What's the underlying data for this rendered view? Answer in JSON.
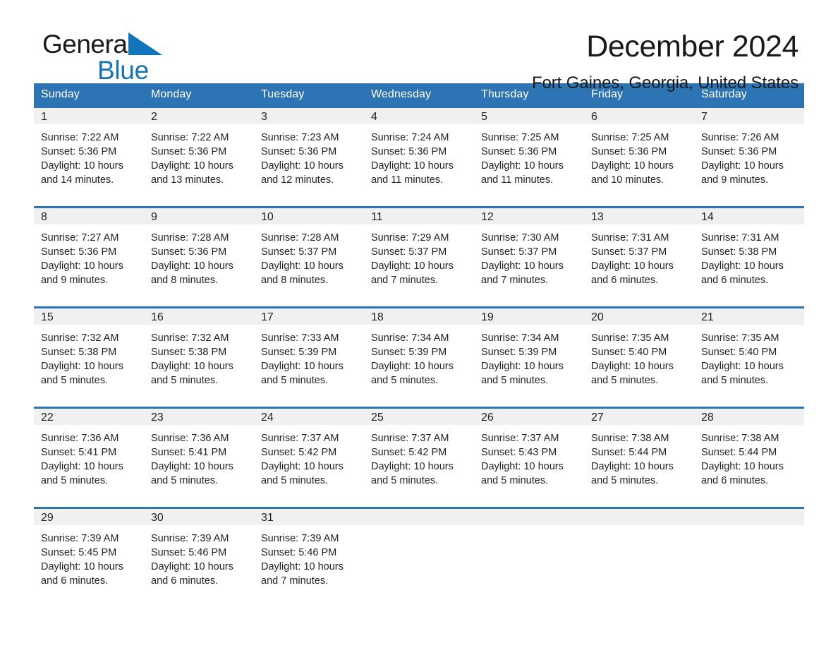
{
  "brand": {
    "name_top": "General",
    "name_bottom": "Blue",
    "triangle_color": "#1275bb",
    "text_color": "#1a1a1a"
  },
  "header": {
    "title": "December 2024",
    "location": "Fort Gaines, Georgia, United States"
  },
  "colors": {
    "header_blue": "#2c74b3",
    "daynum_band": "#f0f0f0",
    "text": "#231f20"
  },
  "calendar": {
    "weekday_headers": [
      "Sunday",
      "Monday",
      "Tuesday",
      "Wednesday",
      "Thursday",
      "Friday",
      "Saturday"
    ],
    "weeks": [
      [
        {
          "day": "1",
          "sunrise": "Sunrise: 7:22 AM",
          "sunset": "Sunset: 5:36 PM",
          "daylight1": "Daylight: 10 hours",
          "daylight2": "and 14 minutes."
        },
        {
          "day": "2",
          "sunrise": "Sunrise: 7:22 AM",
          "sunset": "Sunset: 5:36 PM",
          "daylight1": "Daylight: 10 hours",
          "daylight2": "and 13 minutes."
        },
        {
          "day": "3",
          "sunrise": "Sunrise: 7:23 AM",
          "sunset": "Sunset: 5:36 PM",
          "daylight1": "Daylight: 10 hours",
          "daylight2": "and 12 minutes."
        },
        {
          "day": "4",
          "sunrise": "Sunrise: 7:24 AM",
          "sunset": "Sunset: 5:36 PM",
          "daylight1": "Daylight: 10 hours",
          "daylight2": "and 11 minutes."
        },
        {
          "day": "5",
          "sunrise": "Sunrise: 7:25 AM",
          "sunset": "Sunset: 5:36 PM",
          "daylight1": "Daylight: 10 hours",
          "daylight2": "and 11 minutes."
        },
        {
          "day": "6",
          "sunrise": "Sunrise: 7:25 AM",
          "sunset": "Sunset: 5:36 PM",
          "daylight1": "Daylight: 10 hours",
          "daylight2": "and 10 minutes."
        },
        {
          "day": "7",
          "sunrise": "Sunrise: 7:26 AM",
          "sunset": "Sunset: 5:36 PM",
          "daylight1": "Daylight: 10 hours",
          "daylight2": "and 9 minutes."
        }
      ],
      [
        {
          "day": "8",
          "sunrise": "Sunrise: 7:27 AM",
          "sunset": "Sunset: 5:36 PM",
          "daylight1": "Daylight: 10 hours",
          "daylight2": "and 9 minutes."
        },
        {
          "day": "9",
          "sunrise": "Sunrise: 7:28 AM",
          "sunset": "Sunset: 5:36 PM",
          "daylight1": "Daylight: 10 hours",
          "daylight2": "and 8 minutes."
        },
        {
          "day": "10",
          "sunrise": "Sunrise: 7:28 AM",
          "sunset": "Sunset: 5:37 PM",
          "daylight1": "Daylight: 10 hours",
          "daylight2": "and 8 minutes."
        },
        {
          "day": "11",
          "sunrise": "Sunrise: 7:29 AM",
          "sunset": "Sunset: 5:37 PM",
          "daylight1": "Daylight: 10 hours",
          "daylight2": "and 7 minutes."
        },
        {
          "day": "12",
          "sunrise": "Sunrise: 7:30 AM",
          "sunset": "Sunset: 5:37 PM",
          "daylight1": "Daylight: 10 hours",
          "daylight2": "and 7 minutes."
        },
        {
          "day": "13",
          "sunrise": "Sunrise: 7:31 AM",
          "sunset": "Sunset: 5:37 PM",
          "daylight1": "Daylight: 10 hours",
          "daylight2": "and 6 minutes."
        },
        {
          "day": "14",
          "sunrise": "Sunrise: 7:31 AM",
          "sunset": "Sunset: 5:38 PM",
          "daylight1": "Daylight: 10 hours",
          "daylight2": "and 6 minutes."
        }
      ],
      [
        {
          "day": "15",
          "sunrise": "Sunrise: 7:32 AM",
          "sunset": "Sunset: 5:38 PM",
          "daylight1": "Daylight: 10 hours",
          "daylight2": "and 5 minutes."
        },
        {
          "day": "16",
          "sunrise": "Sunrise: 7:32 AM",
          "sunset": "Sunset: 5:38 PM",
          "daylight1": "Daylight: 10 hours",
          "daylight2": "and 5 minutes."
        },
        {
          "day": "17",
          "sunrise": "Sunrise: 7:33 AM",
          "sunset": "Sunset: 5:39 PM",
          "daylight1": "Daylight: 10 hours",
          "daylight2": "and 5 minutes."
        },
        {
          "day": "18",
          "sunrise": "Sunrise: 7:34 AM",
          "sunset": "Sunset: 5:39 PM",
          "daylight1": "Daylight: 10 hours",
          "daylight2": "and 5 minutes."
        },
        {
          "day": "19",
          "sunrise": "Sunrise: 7:34 AM",
          "sunset": "Sunset: 5:39 PM",
          "daylight1": "Daylight: 10 hours",
          "daylight2": "and 5 minutes."
        },
        {
          "day": "20",
          "sunrise": "Sunrise: 7:35 AM",
          "sunset": "Sunset: 5:40 PM",
          "daylight1": "Daylight: 10 hours",
          "daylight2": "and 5 minutes."
        },
        {
          "day": "21",
          "sunrise": "Sunrise: 7:35 AM",
          "sunset": "Sunset: 5:40 PM",
          "daylight1": "Daylight: 10 hours",
          "daylight2": "and 5 minutes."
        }
      ],
      [
        {
          "day": "22",
          "sunrise": "Sunrise: 7:36 AM",
          "sunset": "Sunset: 5:41 PM",
          "daylight1": "Daylight: 10 hours",
          "daylight2": "and 5 minutes."
        },
        {
          "day": "23",
          "sunrise": "Sunrise: 7:36 AM",
          "sunset": "Sunset: 5:41 PM",
          "daylight1": "Daylight: 10 hours",
          "daylight2": "and 5 minutes."
        },
        {
          "day": "24",
          "sunrise": "Sunrise: 7:37 AM",
          "sunset": "Sunset: 5:42 PM",
          "daylight1": "Daylight: 10 hours",
          "daylight2": "and 5 minutes."
        },
        {
          "day": "25",
          "sunrise": "Sunrise: 7:37 AM",
          "sunset": "Sunset: 5:42 PM",
          "daylight1": "Daylight: 10 hours",
          "daylight2": "and 5 minutes."
        },
        {
          "day": "26",
          "sunrise": "Sunrise: 7:37 AM",
          "sunset": "Sunset: 5:43 PM",
          "daylight1": "Daylight: 10 hours",
          "daylight2": "and 5 minutes."
        },
        {
          "day": "27",
          "sunrise": "Sunrise: 7:38 AM",
          "sunset": "Sunset: 5:44 PM",
          "daylight1": "Daylight: 10 hours",
          "daylight2": "and 5 minutes."
        },
        {
          "day": "28",
          "sunrise": "Sunrise: 7:38 AM",
          "sunset": "Sunset: 5:44 PM",
          "daylight1": "Daylight: 10 hours",
          "daylight2": "and 6 minutes."
        }
      ],
      [
        {
          "day": "29",
          "sunrise": "Sunrise: 7:39 AM",
          "sunset": "Sunset: 5:45 PM",
          "daylight1": "Daylight: 10 hours",
          "daylight2": "and 6 minutes."
        },
        {
          "day": "30",
          "sunrise": "Sunrise: 7:39 AM",
          "sunset": "Sunset: 5:46 PM",
          "daylight1": "Daylight: 10 hours",
          "daylight2": "and 6 minutes."
        },
        {
          "day": "31",
          "sunrise": "Sunrise: 7:39 AM",
          "sunset": "Sunset: 5:46 PM",
          "daylight1": "Daylight: 10 hours",
          "daylight2": "and 7 minutes."
        },
        {
          "day": "",
          "sunrise": "",
          "sunset": "",
          "daylight1": "",
          "daylight2": ""
        },
        {
          "day": "",
          "sunrise": "",
          "sunset": "",
          "daylight1": "",
          "daylight2": ""
        },
        {
          "day": "",
          "sunrise": "",
          "sunset": "",
          "daylight1": "",
          "daylight2": ""
        },
        {
          "day": "",
          "sunrise": "",
          "sunset": "",
          "daylight1": "",
          "daylight2": ""
        }
      ]
    ]
  }
}
